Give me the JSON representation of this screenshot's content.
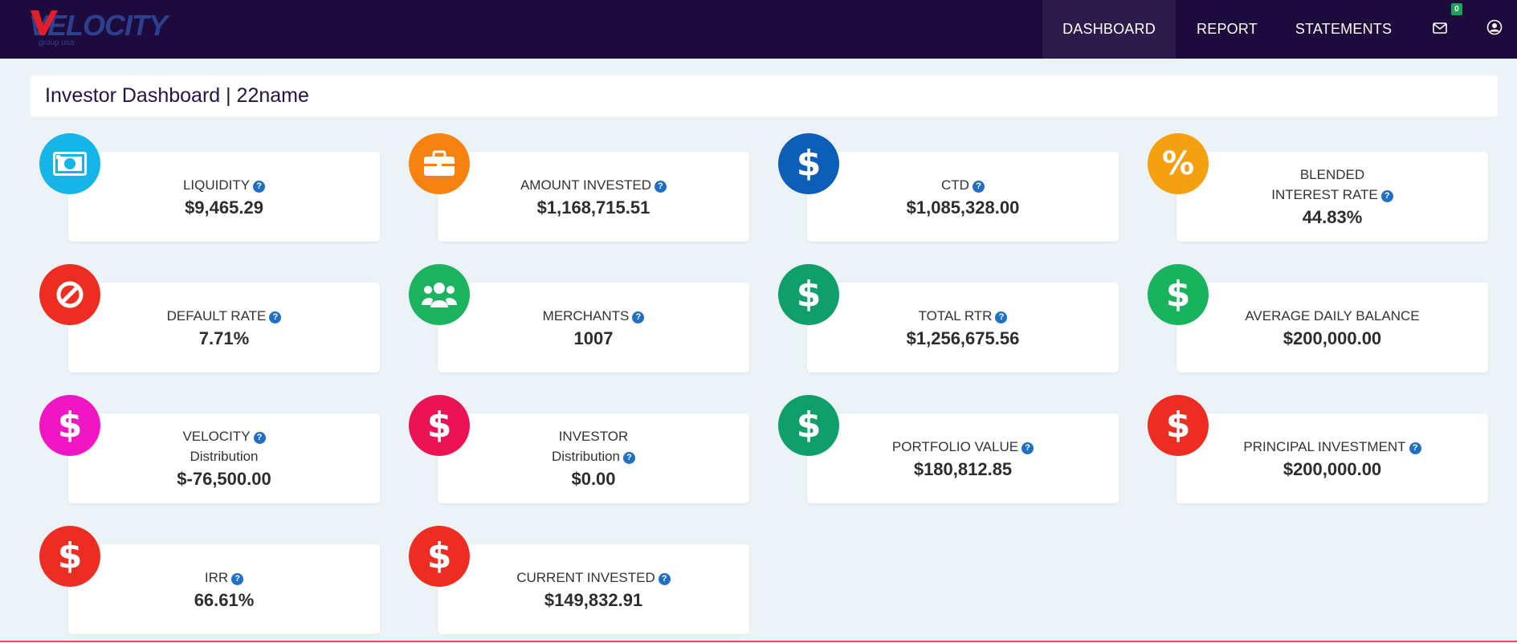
{
  "header": {
    "logo_text": "VELOCITY",
    "logo_sub": "group usa",
    "nav": [
      {
        "label": "DASHBOARD"
      },
      {
        "label": "REPORT"
      },
      {
        "label": "STATEMENTS"
      }
    ],
    "mail_badge": "0"
  },
  "page_title": "Investor Dashboard | 22name",
  "help_glyph": "?",
  "cards": [
    {
      "label": "LIQUIDITY",
      "value": "$9,465.29",
      "icon": "cash-icon",
      "color": "#16b5e8"
    },
    {
      "label": "AMOUNT INVESTED",
      "value": "$1,168,715.51",
      "icon": "briefcase-icon",
      "color": "#f7820f"
    },
    {
      "label": "CTD",
      "value": "$1,085,328.00",
      "icon": "dollar-icon",
      "color": "#0d5eb8"
    },
    {
      "label": "BLENDED",
      "sub": "INTEREST RATE",
      "value": "44.83%",
      "icon": "percent-icon",
      "color": "#f5a00e"
    },
    {
      "label": "DEFAULT RATE",
      "value": "7.71%",
      "icon": "ban-icon",
      "color": "#ee2d22"
    },
    {
      "label": "MERCHANTS",
      "value": "1007",
      "icon": "users-icon",
      "color": "#1bb35f"
    },
    {
      "label": "TOTAL RTR",
      "value": "$1,256,675.56",
      "icon": "dollar-icon",
      "color": "#0e9f6b"
    },
    {
      "label": "AVERAGE DAILY BALANCE",
      "value": "$200,000.00",
      "icon": "dollar-icon",
      "color": "#18b45d"
    },
    {
      "label": "VELOCITY",
      "sub": "Distribution",
      "value": "$-76,500.00",
      "icon": "dollar-icon",
      "color": "#f016c4"
    },
    {
      "label": "INVESTOR",
      "sub": "Distribution",
      "value": "$0.00",
      "icon": "dollar-icon",
      "color": "#ec1355"
    },
    {
      "label": "PORTFOLIO VALUE",
      "value": "$180,812.85",
      "icon": "dollar-icon",
      "color": "#0e9f6b"
    },
    {
      "label": "PRINCIPAL INVESTMENT",
      "value": "$200,000.00",
      "icon": "dollar-icon",
      "color": "#ee2d22"
    },
    {
      "label": "IRR",
      "value": "66.61%",
      "icon": "dollar-icon",
      "color": "#ee2d22"
    },
    {
      "label": "CURRENT INVESTED",
      "value": "$149,832.91",
      "icon": "dollar-icon",
      "color": "#ee2d22"
    }
  ]
}
